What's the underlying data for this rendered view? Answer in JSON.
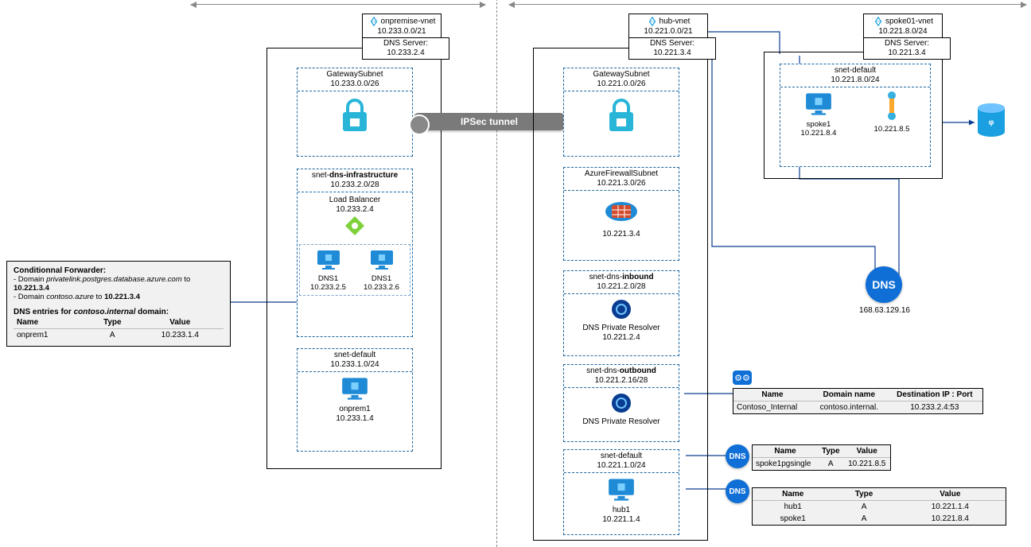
{
  "labels": {
    "ipsec_tunnel": "IPSec tunnel",
    "dns_azure_ip": "168.63.129.16",
    "dns_badge": "DNS"
  },
  "vnets": {
    "onprem": {
      "name": "onpremise-vnet",
      "cidr": "10.233.0.0/21",
      "dns": "DNS Server: 10.233.2.4",
      "subnets": {
        "gateway": {
          "name": "GatewaySubnet",
          "cidr": "10.233.0.0/26"
        },
        "dns_infra": {
          "name_prefix": "snet-",
          "name_bold": "dns-infrastructure",
          "cidr": "10.233.2.0/28",
          "lb_name": "Load Balancer",
          "lb_ip": "10.233.2.4",
          "dns1_name": "DNS1",
          "dns1_ip": "10.233.2.5",
          "dns2_name": "DNS1",
          "dns2_ip": "10.233.2.6"
        },
        "default": {
          "name": "snet-default",
          "cidr": "10.233.1.0/24",
          "vm_name": "onprem1",
          "vm_ip": "10.233.1.4"
        }
      }
    },
    "hub": {
      "name": "hub-vnet",
      "cidr": "10.221.0.0/21",
      "dns": "DNS Server: 10.221.3.4",
      "subnets": {
        "gateway": {
          "name": "GatewaySubnet",
          "cidr": "10.221.0.0/26"
        },
        "firewall": {
          "name": "AzureFirewallSubnet",
          "cidr": "10.221.3.0/26",
          "fw_ip": "10.221.3.4"
        },
        "dns_in": {
          "name_prefix": "snet-dns-",
          "name_bold": "inbound",
          "cidr": "10.221.2.0/28",
          "svc_name": "DNS Private Resolver",
          "svc_ip": "10.221.2.4"
        },
        "dns_out": {
          "name_prefix": "snet-dns-",
          "name_bold": "outbound",
          "cidr": "10.221.2.16/28",
          "svc_name": "DNS Private Resolver"
        },
        "default": {
          "name": "snet-default",
          "cidr": "10.221.1.0/24",
          "vm_name": "hub1",
          "vm_ip": "10.221.1.4"
        }
      }
    },
    "spoke": {
      "name": "spoke01-vnet",
      "cidr": "10.221.8.0/24",
      "dns": "DNS Server: 10.221.3.4",
      "subnets": {
        "default": {
          "name": "snet-default",
          "cidr": "10.221.8.0/24",
          "vm_name": "spoke1",
          "vm_ip": "10.221.8.4",
          "pe_ip": "10.221.8.5"
        }
      }
    }
  },
  "onprem_note": {
    "title": "Conditionnal Forwarder:",
    "line1_pre": "- Domain ",
    "line1_em": "privatelink.postgres.database.azure.com",
    "line1_post": " to ",
    "line1_ip": "10.221.3.4",
    "line2_pre": "- Domain ",
    "line2_em": "contoso.azure",
    "line2_post": " to ",
    "line2_ip": "10.221.3.4",
    "entries_title_pre": "DNS entries for ",
    "entries_title_em": "contoso.internal",
    "entries_title_post": " domain:",
    "th_name": "Name",
    "th_type": "Type",
    "th_value": "Value",
    "r1_name": "onprem1",
    "r1_type": "A",
    "r1_value": "10.233.1.4"
  },
  "fwd_rule_tbl": {
    "th_name": "Name",
    "th_domain": "Domain name",
    "th_dest": "Destination IP : Port",
    "r1_name": "Contoso_Internal",
    "r1_domain": "contoso.internal.",
    "r1_dest": "10.233.2.4:53"
  },
  "pgsingle_tbl": {
    "th_name": "Name",
    "th_type": "Type",
    "th_value": "Value",
    "r1_name": "spoke1pgsingle",
    "r1_type": "A",
    "r1_value": "10.221.8.5"
  },
  "contoso_azure_tbl": {
    "th_name": "Name",
    "th_type": "Type",
    "th_value": "Value",
    "r1_name": "hub1",
    "r1_type": "A",
    "r1_value": "10.221.1.4",
    "r2_name": "spoke1",
    "r2_type": "A",
    "r2_value": "10.221.8.4"
  }
}
